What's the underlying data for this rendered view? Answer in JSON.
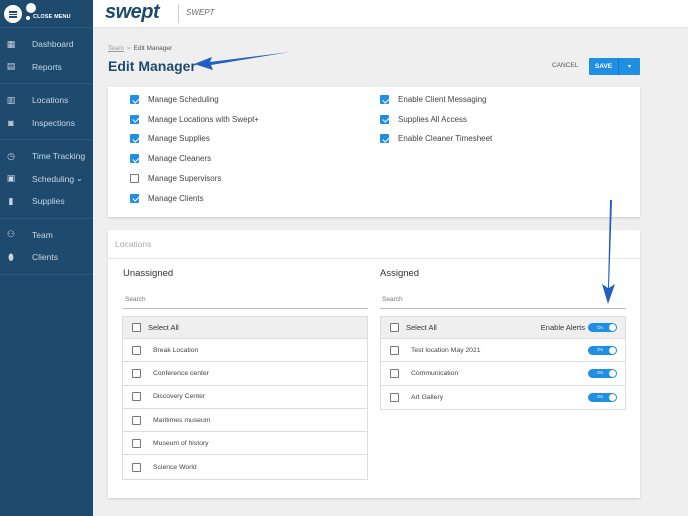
{
  "sidebar": {
    "close_menu_label": "CLOSE MENU",
    "groups": [
      [
        {
          "label": "Dashboard",
          "icon": "dashboard-icon"
        },
        {
          "label": "Reports",
          "icon": "reports-icon"
        }
      ],
      [
        {
          "label": "Locations",
          "icon": "locations-icon"
        },
        {
          "label": "Inspections",
          "icon": "inspections-icon"
        }
      ],
      [
        {
          "label": "Time Tracking",
          "icon": "stopwatch-icon"
        },
        {
          "label": "Scheduling",
          "icon": "calendar-icon"
        },
        {
          "label": "Supplies",
          "icon": "supplies-icon"
        }
      ],
      [
        {
          "label": "Team",
          "icon": "team-icon"
        },
        {
          "label": "Clients",
          "icon": "location-pin-icon"
        }
      ]
    ]
  },
  "header": {
    "logo": "swept",
    "org_name": "SWEPT"
  },
  "page": {
    "breadcrumb_parent": "Team",
    "breadcrumb_separator": "»",
    "breadcrumb_current": "Edit Manager",
    "title": "Edit Manager",
    "cancel_label": "CANCEL",
    "save_label": "SAVE",
    "save_dropdown_icon": "▾"
  },
  "permissions": {
    "left": [
      {
        "label": "Manage Scheduling",
        "checked": true
      },
      {
        "label": "Manage Locations with Swept+",
        "checked": true
      },
      {
        "label": "Manage Supplies",
        "checked": true
      },
      {
        "label": "Manage Cleaners",
        "checked": true
      },
      {
        "label": "Manage Supervisors",
        "checked": false
      },
      {
        "label": "Manage Clients",
        "checked": true
      }
    ],
    "right": [
      {
        "label": "Enable Client Messaging",
        "checked": true
      },
      {
        "label": "Supplies All Access",
        "checked": true
      },
      {
        "label": "Enable Cleaner Timesheet",
        "checked": true
      }
    ]
  },
  "locations": {
    "title": "Locations",
    "unassigned": {
      "title": "Unassigned",
      "search_placeholder": "Search",
      "select_all_label": "Select All",
      "items": [
        "Break Location",
        "Conference center",
        "Discovery Center",
        "Maritimes museum",
        "Museum of history",
        "Science World"
      ]
    },
    "assigned": {
      "title": "Assigned",
      "search_placeholder": "Search",
      "select_all_label": "Select All",
      "enable_alerts_label": "Enable Alerts",
      "toggle_on_label": "On",
      "items": [
        {
          "label": "Test location May 2021",
          "alerts": true
        },
        {
          "label": "Communication",
          "alerts": true
        },
        {
          "label": "Art Gallery",
          "alerts": true
        }
      ]
    }
  },
  "colors": {
    "sidebar": "#1e4a6e",
    "accent": "#1e8fe3",
    "annotation_arrow": "#1f5fc4"
  }
}
